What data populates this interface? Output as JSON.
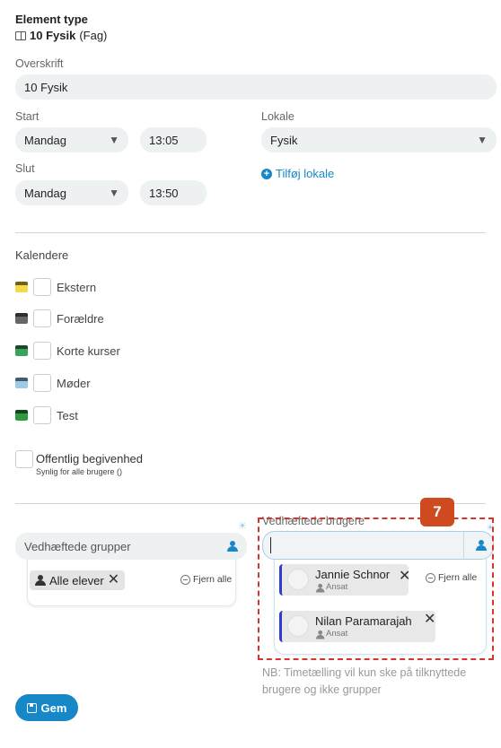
{
  "element_type": {
    "title": "Element type",
    "value": "10 Fysik",
    "suffix": "(Fag)"
  },
  "overskrift": {
    "label": "Overskrift",
    "value": "10 Fysik"
  },
  "start": {
    "label": "Start",
    "day": "Mandag",
    "time": "13:05"
  },
  "slut": {
    "label": "Slut",
    "day": "Mandag",
    "time": "13:50"
  },
  "lokale": {
    "label": "Lokale",
    "value": "Fysik",
    "add_label": "Tilføj lokale"
  },
  "kalendere": {
    "label": "Kalendere",
    "items": [
      {
        "name": "Ekstern",
        "color": "#f5d94a"
      },
      {
        "name": "Forældre",
        "color": "#666666"
      },
      {
        "name": "Korte kurser",
        "color": "#3aa35a"
      },
      {
        "name": "Møder",
        "color": "#9ccbe8"
      },
      {
        "name": "Test",
        "color": "#2f9a3f"
      }
    ]
  },
  "offentlig": {
    "label": "Offentlig begivenhed",
    "sub": "Synlig for alle brugere ()"
  },
  "groups": {
    "label": "Vedhæftede grupper",
    "chip": "Alle elever",
    "remove_all": "Fjern alle"
  },
  "users": {
    "label": "Vedhæftede brugere",
    "input_value": "",
    "remove_all": "Fjern alle",
    "items": [
      {
        "name": "Jannie Schnor",
        "role": "Ansat"
      },
      {
        "name": "Nilan Paramarajah",
        "role": "Ansat"
      }
    ],
    "note": "NB: Timetælling vil kun ske på tilknyttede brugere og ikke grupper"
  },
  "annotation": {
    "badge": "7"
  },
  "save": {
    "label": "Gem"
  },
  "colors": {
    "accent": "#1688c8",
    "annotation": "#d9342b",
    "badge_bg": "#cf4b1f"
  }
}
